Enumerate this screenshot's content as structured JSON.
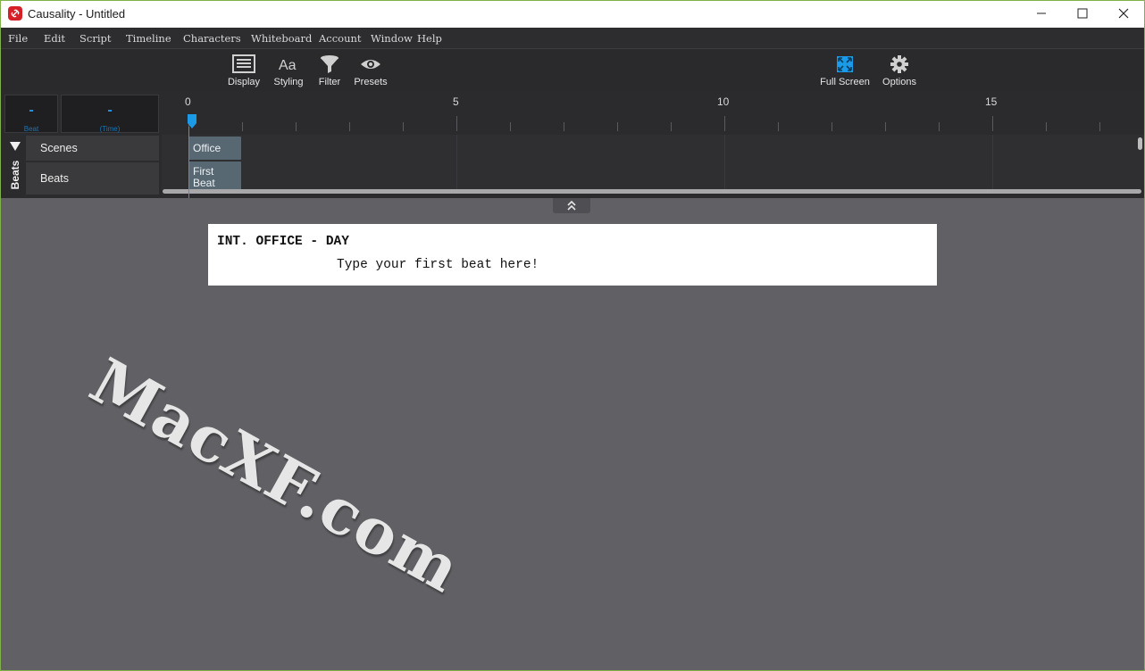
{
  "window": {
    "title": "Causality - Untitled"
  },
  "menu": [
    "File",
    "Edit",
    "Script",
    "Timeline",
    "Characters",
    "Whiteboard",
    "Account",
    "Window",
    "Help"
  ],
  "toolbar": {
    "display": "Display",
    "styling": "Styling",
    "filter": "Filter",
    "presets": "Presets",
    "fullscreen": "Full Screen",
    "options": "Options"
  },
  "timeline": {
    "beat_value": "-",
    "beat_caption": "Beat",
    "time_value": "-",
    "time_caption": "(Time)",
    "ticks": [
      "0",
      "5",
      "10",
      "15"
    ],
    "side_label": "Beats",
    "rows": {
      "scenes": "Scenes",
      "beats": "Beats"
    },
    "scene_block": "Office",
    "beat_block": "First Beat"
  },
  "script": {
    "slugline": "INT. OFFICE - DAY",
    "beat_text": "Type your first beat here!"
  },
  "watermark": "MacXF.com",
  "colors": {
    "accent": "#1b9ae8",
    "block": "#586873",
    "background": "#616165"
  }
}
